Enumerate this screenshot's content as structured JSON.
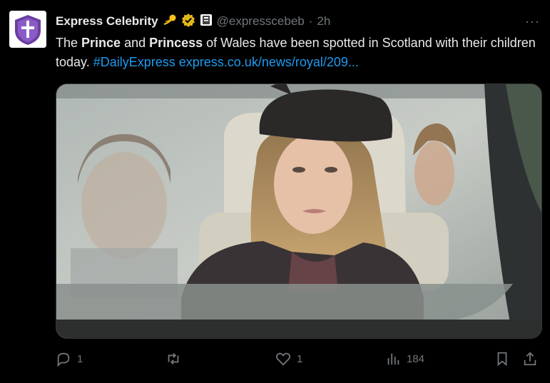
{
  "tweet": {
    "author_name": "Express Celebrity",
    "handle": "@expresscebeb",
    "separator": "·",
    "time": "2h",
    "text_parts": {
      "p1": "The ",
      "b1": "Prince",
      "p2": " and ",
      "b2": "Princess",
      "p3": " of Wales have been spotted in Scotland with their children today. ",
      "hashtag": "#DailyExpress",
      "space": " ",
      "url": "express.co.uk/news/royal/209..."
    },
    "more_label": "···"
  },
  "actions": {
    "replies": "1",
    "reposts": "",
    "likes": "1",
    "views": "184"
  },
  "icons": {
    "emoji": "dizzy-icon",
    "verified": "verified-gold-badge-icon",
    "affiliate": "affiliate-badge-icon"
  },
  "colors": {
    "background": "#000000",
    "text": "#e7e9ea",
    "muted": "#71767b",
    "link": "#1d9bf0",
    "verified_gold": "#e2b719"
  }
}
